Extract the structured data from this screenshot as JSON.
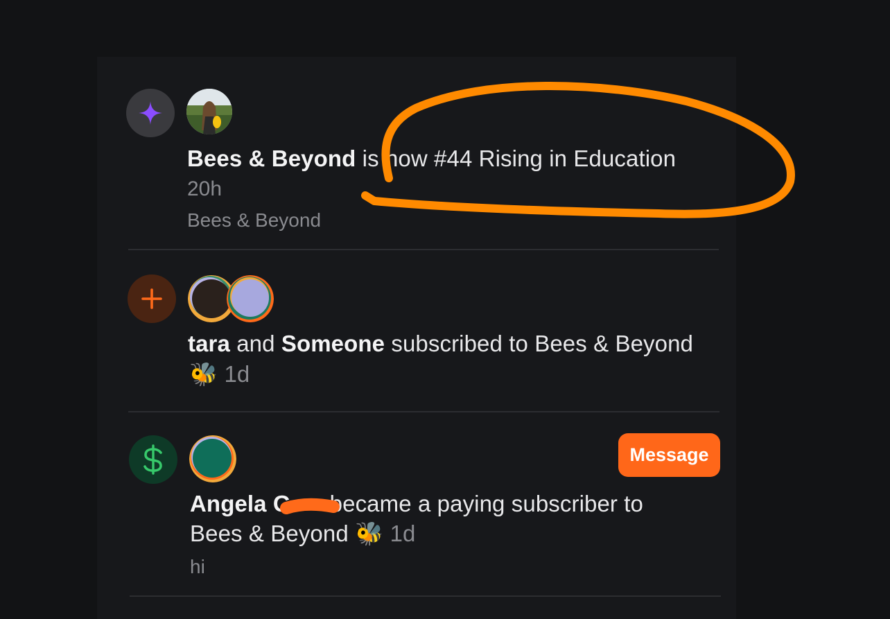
{
  "notifications": [
    {
      "type_icon": "sparkle-icon",
      "avatars": [
        "publication-avatar"
      ],
      "bold_text": "Bees & Beyond",
      "text": " is now #44 Rising in Education",
      "time": "20h",
      "subtext": "Bees & Beyond"
    },
    {
      "type_icon": "plus-icon",
      "avatars": [
        "user-avatar-tara",
        "user-avatar-someone"
      ],
      "bold_text_1": "tara",
      "connector": " and ",
      "bold_text_2": "Someone",
      "text": " subscribed to Bees & Beyond",
      "emoji": "🐝",
      "time": "1d"
    },
    {
      "type_icon": "dollar-icon",
      "avatars": [
        "user-avatar-angela"
      ],
      "bold_text": "Angela G",
      "text": "became a paying subscriber to",
      "text_line2": "Bees & Beyond",
      "emoji": "🐝",
      "time": "1d",
      "subtext": "hi",
      "button_label": "Message"
    }
  ],
  "colors": {
    "background": "#121315",
    "panel": "#17181b",
    "accent": "#ff6719",
    "annotation": "#ff8a00",
    "sparkle": "#8b4dff",
    "plus": "#ff6a1a",
    "dollar": "#37c96b"
  }
}
